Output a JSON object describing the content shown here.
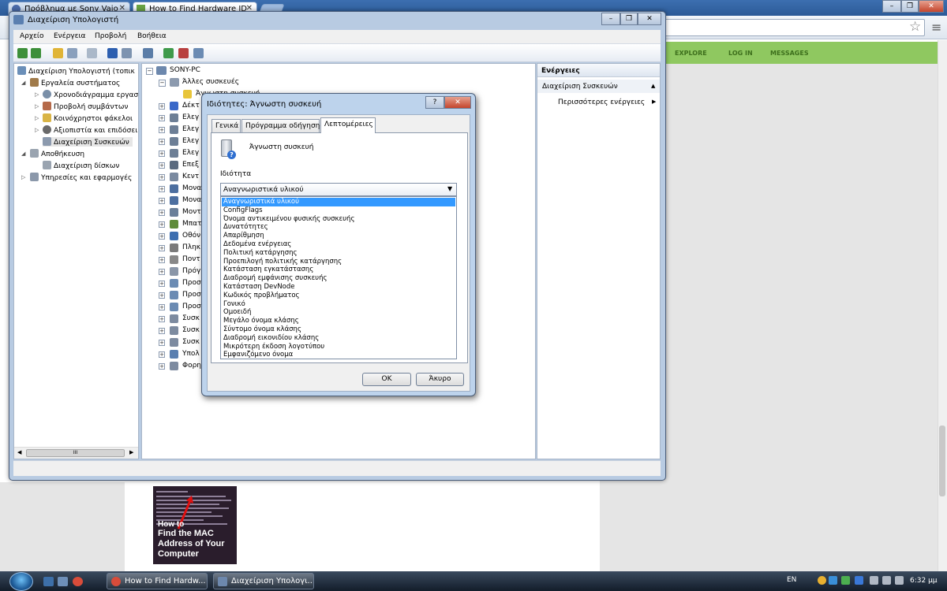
{
  "browser": {
    "tabs": [
      {
        "label": "Πρόβλημα με Sony Vaio"
      },
      {
        "label": "How to Find Hardware ID"
      }
    ],
    "window_controls": {
      "minimize": "–",
      "restore": "❐",
      "close": "✕"
    },
    "omnibox_star": "☆",
    "menu_icon": "≡"
  },
  "site": {
    "nav": [
      "EXPLORE",
      "LOG IN",
      "MESSAGES"
    ],
    "thumbnail": {
      "caption_lines": [
        "How to",
        "Find the MAC",
        "Address of Your",
        "Computer"
      ]
    }
  },
  "computer_management": {
    "title": "Διαχείριση Υπολογιστή",
    "menu": [
      "Αρχείο",
      "Ενέργεια",
      "Προβολή",
      "Βοήθεια"
    ],
    "tree": [
      "Διαχείριση Υπολογιστή (τοπικ",
      "Εργαλεία συστήματος",
      "Χρονοδιάγραμμα εργασ",
      "Προβολή συμβάντων",
      "Κοινόχρηστοι φάκελοι",
      "Αξιοπιστία και επιδόσει",
      "Διαχείριση Συσκευών",
      "Αποθήκευση",
      "Διαχείριση δίσκων",
      "Υπηρεσίες και εφαρμογές"
    ],
    "devices": {
      "root": "SONY-PC",
      "other_devices": "Άλλες συσκευές",
      "unknown_device": "Άγνωστη συσκευή",
      "rows": [
        "Δέκτ",
        "Ελεγ",
        "Ελεγ",
        "Ελεγ",
        "Ελεγ",
        "Επεξ",
        "Κεντ",
        "Μονα",
        "Μονα",
        "Μοντ",
        "Μπατ",
        "Οθόν",
        "Πληκ",
        "Ποντ",
        "Πρόγ",
        "Προσ",
        "Προσ",
        "Προσ",
        "Συσκ",
        "Συσκ",
        "Συσκ",
        "Υπολ",
        "Φορη"
      ]
    },
    "actions": {
      "header": "Ενέργειες",
      "section": "Διαχείριση Συσκευών",
      "more": "Περισσότερες ενέργειες",
      "collapse_glyph": "▲",
      "more_glyph": "▶"
    },
    "scroll_glyphs": {
      "left": "◀",
      "right": "▶",
      "grip": "III"
    }
  },
  "properties_dialog": {
    "title": "Ιδιότητες: Άγνωστη συσκευή",
    "help": "?",
    "close": "✕",
    "tabs": [
      "Γενικά",
      "Πρόγραμμα οδήγησης",
      "Λεπτομέρειες"
    ],
    "device_name": "Άγνωστη συσκευή",
    "property_label": "Ιδιότητα",
    "selected_property": "Αναγνωριστικά υλικού",
    "options": [
      "Αναγνωριστικά υλικού",
      "ConfigFlags",
      "Όνομα αντικειμένου φυσικής συσκευής",
      "Δυνατότητες",
      "Απαρίθμηση",
      "Δεδομένα ενέργειας",
      "Πολιτική κατάργησης",
      "Προεπιλογή πολιτικής κατάργησης",
      "Κατάσταση εγκατάστασης",
      "Διαδρομή εμφάνισης συσκευής",
      "Κατάσταση DevNode",
      "Κωδικός προβλήματος",
      "Γονικό",
      "Ομοειδή",
      "Μεγάλο όνομα κλάσης",
      "Σύντομο όνομα κλάσης",
      "Διαδρομή εικονιδίου κλάσης",
      "Μικρότερη έκδοση λογοτύπου",
      "Εμφανιζόμενο όνομα"
    ],
    "ok": "ΟΚ",
    "cancel": "Άκυρο"
  },
  "taskbar": {
    "buttons": [
      "How to Find Hardw...",
      "Διαχείριση Υπολογι..."
    ],
    "language": "EN",
    "clock": "6:32 μμ"
  }
}
